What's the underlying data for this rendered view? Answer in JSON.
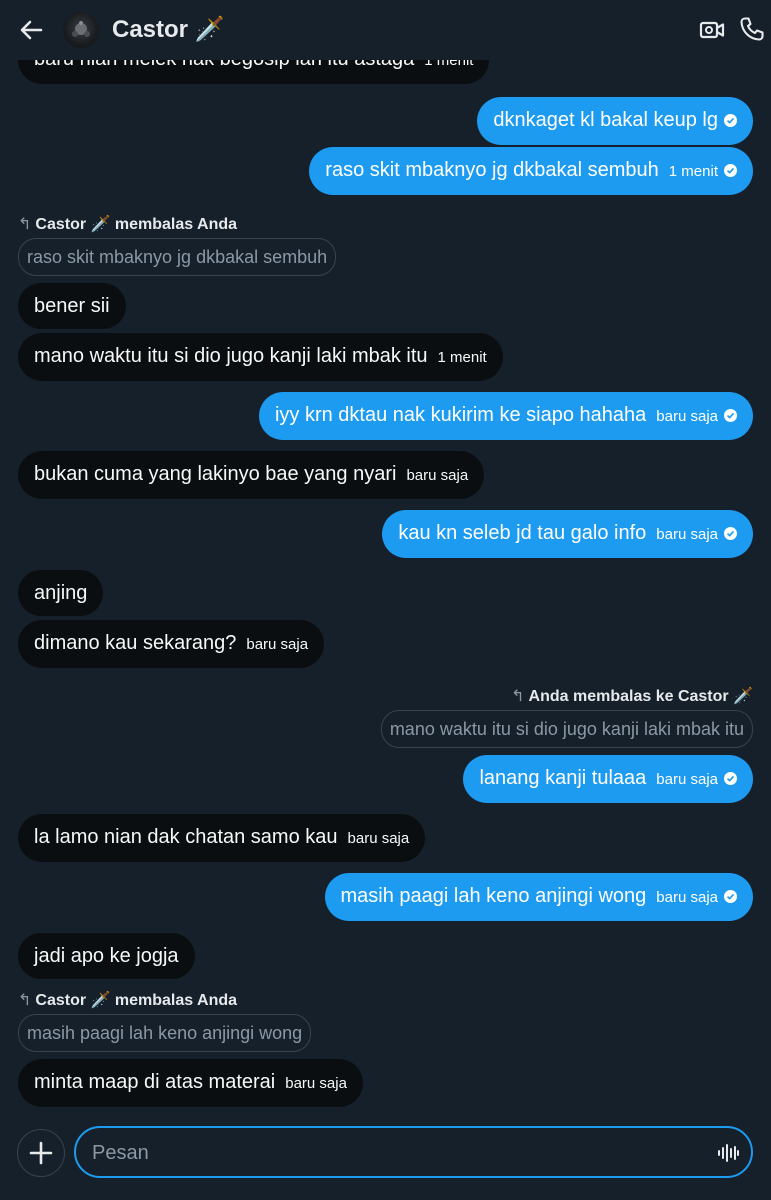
{
  "header": {
    "title": "Castor 🗡️"
  },
  "messages": [
    {
      "text": "baru nian melek nak begosip lah itu astaga",
      "time": "1 menit"
    },
    {
      "text": "dknkaget kl bakal keup lg",
      "time": ""
    },
    {
      "text": "raso skit mbaknyo jg dkbakal sembuh",
      "time": "1 menit"
    },
    {
      "reply_label": "Castor 🗡️ membalas Anda",
      "quote": "raso skit mbaknyo jg dkbakal sembuh"
    },
    {
      "text": "bener sii",
      "time": ""
    },
    {
      "text": "mano waktu itu si dio jugo kanji laki mbak itu",
      "time": "1 menit"
    },
    {
      "text": "iyy krn dktau nak kukirim ke siapo hahaha",
      "time": "baru saja"
    },
    {
      "text": "bukan cuma yang lakinyo bae yang nyari",
      "time": "baru saja"
    },
    {
      "text": "kau kn seleb jd tau galo info",
      "time": "baru saja"
    },
    {
      "text": "anjing",
      "time": ""
    },
    {
      "text": "dimano kau sekarang?",
      "time": "baru saja"
    },
    {
      "reply_label": "Anda membalas ke Castor 🗡️",
      "quote": "mano waktu itu si dio jugo kanji laki mbak itu"
    },
    {
      "text": "lanang kanji tulaaa",
      "time": "baru saja"
    },
    {
      "text": "la lamo nian dak chatan samo kau",
      "time": "baru saja"
    },
    {
      "text": "masih paagi lah keno anjingi wong",
      "time": "baru saja"
    },
    {
      "text": "jadi apo ke jogja",
      "time": ""
    },
    {
      "reply_label": "Castor 🗡️ membalas Anda",
      "quote": "masih paagi lah keno anjingi wong"
    },
    {
      "text": "minta maap di atas materai",
      "time": "baru saja"
    }
  ],
  "composer": {
    "placeholder": "Pesan",
    "value": ""
  },
  "icons": {
    "back": "arrow-left-icon",
    "video": "video-call-icon",
    "phone": "phone-icon",
    "plus": "plus-icon",
    "audio": "audio-waveform-icon",
    "read": "check-circle-icon"
  },
  "colors": {
    "background": "#15202b",
    "incoming_bubble": "#0b0e11",
    "outgoing_bubble": "#1d9bf0",
    "muted_text": "#8b98a5",
    "border": "#38444d"
  }
}
